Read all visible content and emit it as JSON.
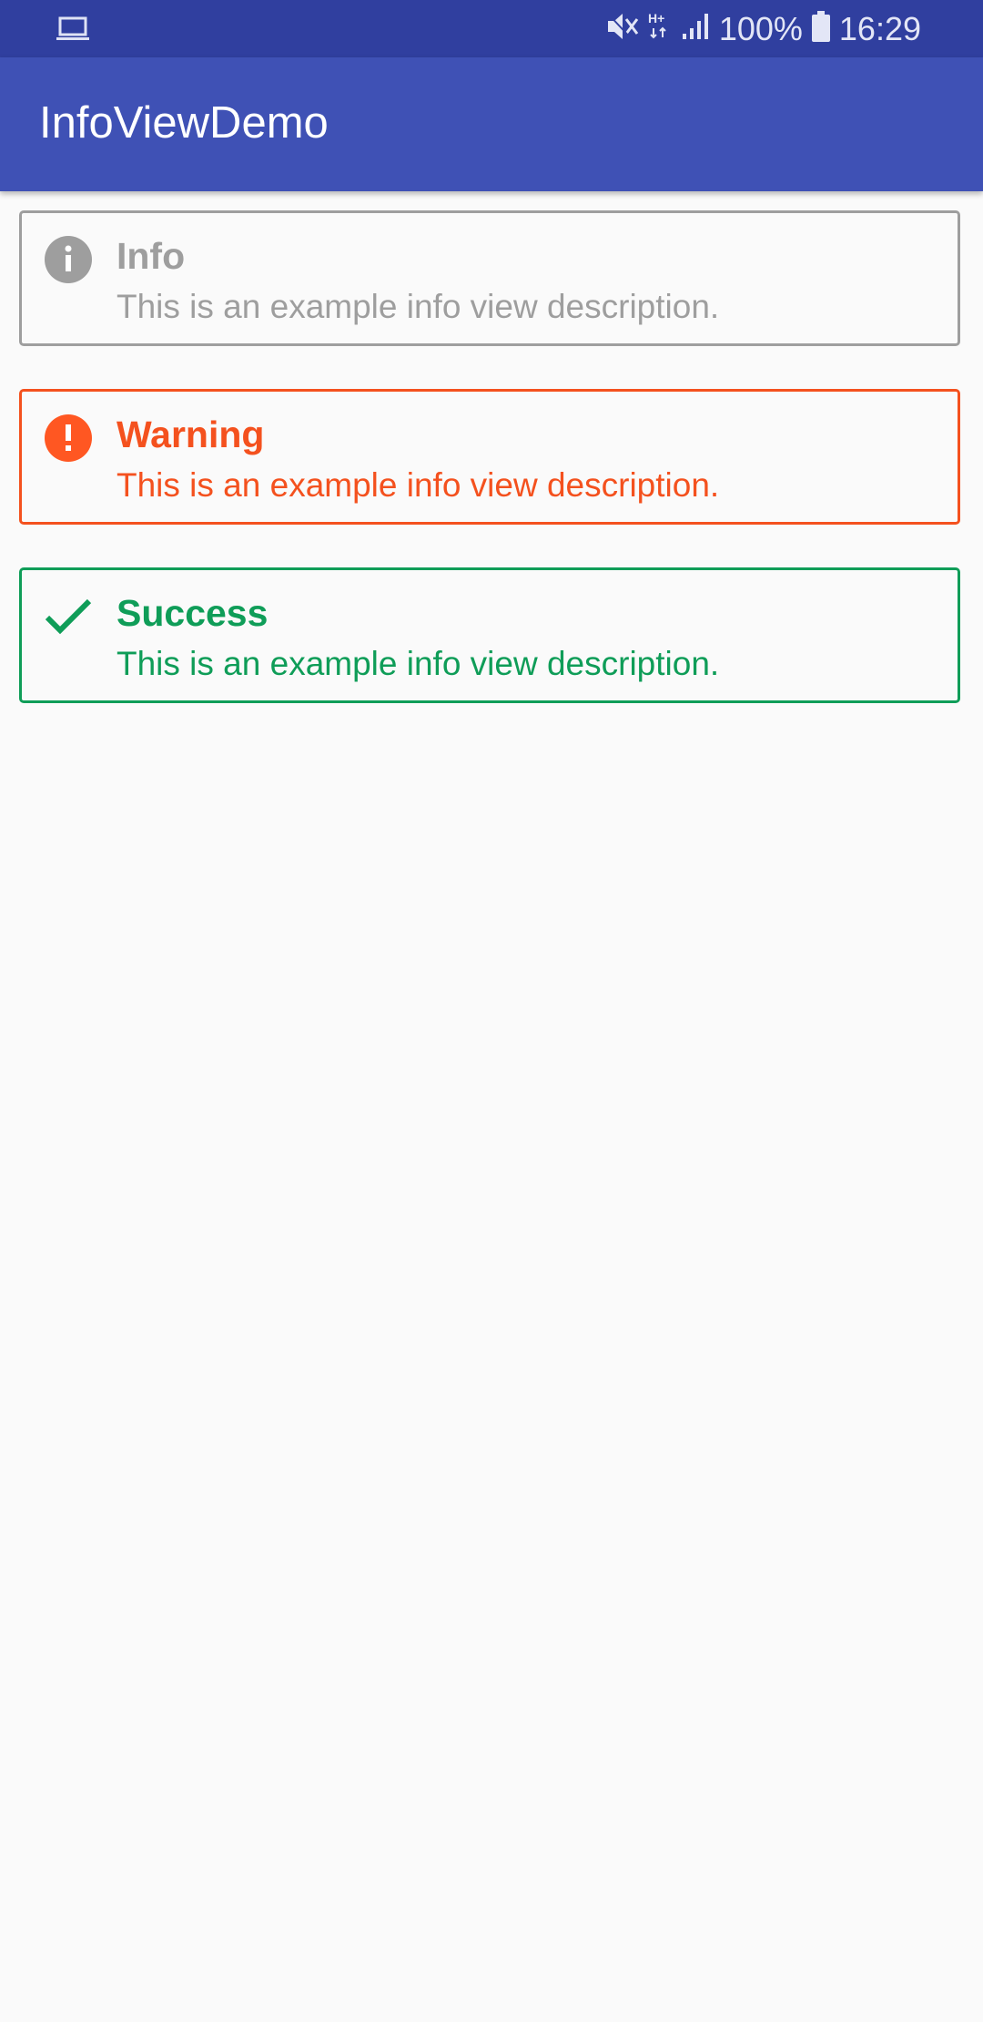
{
  "status_bar": {
    "left_icon": "laptop-icon",
    "battery_percent": "100%",
    "time": "16:29",
    "icons": [
      "mute-icon",
      "hplus-data-icon",
      "signal-icon",
      "battery-icon"
    ]
  },
  "app_bar": {
    "title": "InfoViewDemo",
    "color": "#3f51b5",
    "status_color": "#303f9f"
  },
  "cards": [
    {
      "type": "info",
      "icon": "info-icon",
      "title": "Info",
      "description": "This is an example info view description.",
      "color": "#9e9e9e"
    },
    {
      "type": "warning",
      "icon": "exclamation-icon",
      "title": "Warning",
      "description": "This is an example info view description.",
      "color": "#f4511e"
    },
    {
      "type": "success",
      "icon": "checkmark-icon",
      "title": "Success",
      "description": "This is an example info view description.",
      "color": "#0f9d58"
    }
  ]
}
